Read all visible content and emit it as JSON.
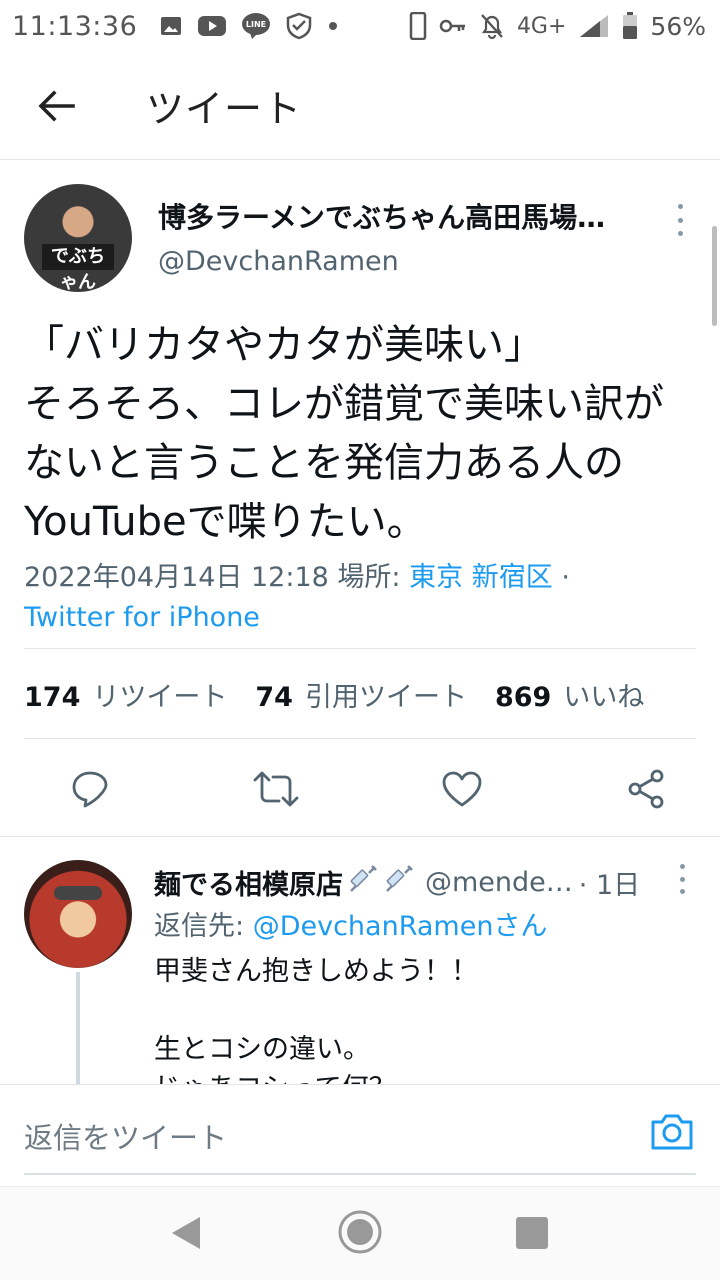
{
  "status_bar": {
    "time": "11:13:36",
    "network": "4G+",
    "battery": "56%",
    "notification_icons": [
      "gallery-icon",
      "youtube-icon",
      "line-icon",
      "shield-check-icon",
      "dot-icon"
    ],
    "system_icons": [
      "phone-icon",
      "key-icon",
      "mute-bell-icon",
      "signal-icon",
      "battery-icon"
    ]
  },
  "header": {
    "title": "ツイート"
  },
  "tweet": {
    "display_name": "博多ラーメンでぶちゃん高田馬場…",
    "handle": "@DevchanRamen",
    "avatar_badge": "でぶちゃん",
    "text": "「バリカタやカタが美味い」\nそろそろ、コレが錯覚で美味い訳がないと言うことを発信力ある人のYouTubeで喋りたい。",
    "date": "2022年04月14日 12:18",
    "place_label": "場所:",
    "place": "東京 新宿区",
    "separator": "·",
    "source": "Twitter for iPhone",
    "stats": {
      "retweets_count": "174",
      "retweets_label": "リツイート",
      "quotes_count": "74",
      "quotes_label": "引用ツイート",
      "likes_count": "869",
      "likes_label": "いいね"
    }
  },
  "reply": {
    "display_name": "麺でる相模原店",
    "handle": "@mende…",
    "time": "· 1日",
    "reply_to_label": "返信先:",
    "reply_to_user": "@DevchanRamenさん",
    "text": "甲斐さん抱きしめよう！！\n\n生とコシの違い。\nじゃあコシって何？"
  },
  "compose": {
    "placeholder": "返信をツイート"
  },
  "colors": {
    "link": "#1d9bf0",
    "secondary_text": "#536471",
    "primary_text": "#0f1419"
  }
}
